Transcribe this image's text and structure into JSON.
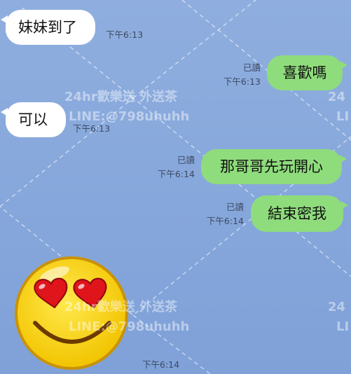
{
  "messages": [
    {
      "text": "妹妹到了",
      "time": "下午6:13"
    },
    {
      "text": "喜歡嗎",
      "read": "已讀",
      "time": "下午6:13"
    },
    {
      "text": "可以",
      "time": "下午6:13"
    },
    {
      "text": "那哥哥先玩開心",
      "read": "已讀",
      "time": "下午6:14"
    },
    {
      "text": "結束密我",
      "read": "已讀",
      "time": "下午6:14"
    }
  ],
  "sticker": {
    "icon": "heart-eyes-smiley-icon",
    "time": "下午6:14"
  },
  "watermark": {
    "line1": "24hr歡樂送 外送茶",
    "line2": "LINE:@798uhuhh",
    "partial1": "24",
    "partial2": "LI"
  },
  "colors": {
    "background": "#86a7db",
    "outgoing": "#8fdc7c",
    "incoming": "#ffffff"
  }
}
